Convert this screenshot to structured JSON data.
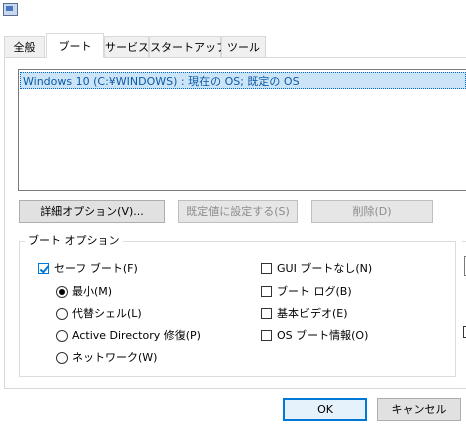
{
  "tabs": [
    {
      "label": "全般"
    },
    {
      "label": "ブート"
    },
    {
      "label": "サービス"
    },
    {
      "label": "スタートアップ"
    },
    {
      "label": "ツール"
    }
  ],
  "boot_list": {
    "items": [
      "Windows 10 (C:¥WINDOWS) : 現在の OS; 既定の OS"
    ]
  },
  "buttons": {
    "advanced": "詳細オプション(V)...",
    "set_default": "既定値に設定する(S)",
    "delete": "削除(D)",
    "ok": "OK",
    "cancel": "キャンセル"
  },
  "boot_options": {
    "title": "ブート オプション",
    "safe_boot": {
      "label": "セーフ ブート(F)",
      "checked": true
    },
    "minimal": {
      "label": "最小(M)",
      "selected": true
    },
    "alternate_shell": {
      "label": "代替シェル(L)",
      "selected": false
    },
    "active_directory": {
      "label": "Active Directory 修復(P)",
      "selected": false
    },
    "network": {
      "label": "ネットワーク(W)",
      "selected": false
    },
    "no_gui_boot": {
      "label": "GUI ブートなし(N)",
      "checked": false
    },
    "boot_log": {
      "label": "ブート ログ(B)",
      "checked": false
    },
    "base_video": {
      "label": "基本ビデオ(E)",
      "checked": false
    },
    "os_boot_info": {
      "label": "OS ブート情報(O)",
      "checked": false
    }
  },
  "colors": {
    "accent": "#0078d7",
    "selection": "#cce4f7"
  }
}
